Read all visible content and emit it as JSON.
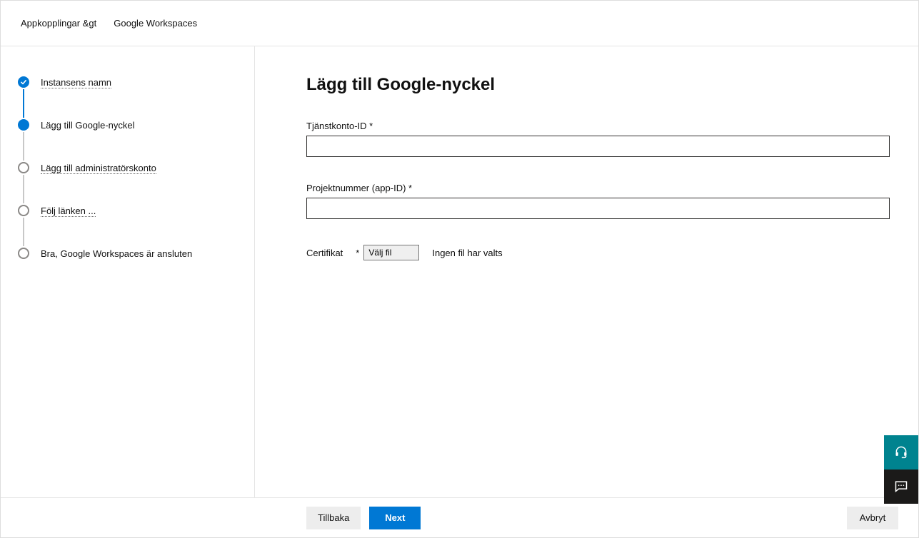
{
  "breadcrumb": {
    "item1": "Appkopplingar &gt",
    "item2": "Google Workspaces"
  },
  "stepper": {
    "steps": [
      {
        "label": "Instansens namn"
      },
      {
        "label": "Lägg till Google-nyckel"
      },
      {
        "label": "Lägg till administratörskonto"
      },
      {
        "label": "Följ länken ..."
      },
      {
        "label": "Bra, Google Workspaces är ansluten"
      }
    ]
  },
  "main": {
    "title": "Lägg till Google-nyckel",
    "field1_label": "Tjänstkonto-ID *",
    "field1_value": "",
    "field2_label": "Projektnummer (app-ID) *",
    "field2_value": "",
    "cert_label": "Certifikat",
    "cert_asterisk": "*",
    "cert_button": "Välj fil",
    "cert_status": "Ingen fil har valts"
  },
  "footer": {
    "back": "Tillbaka",
    "next": "Next",
    "cancel": "Avbryt"
  }
}
